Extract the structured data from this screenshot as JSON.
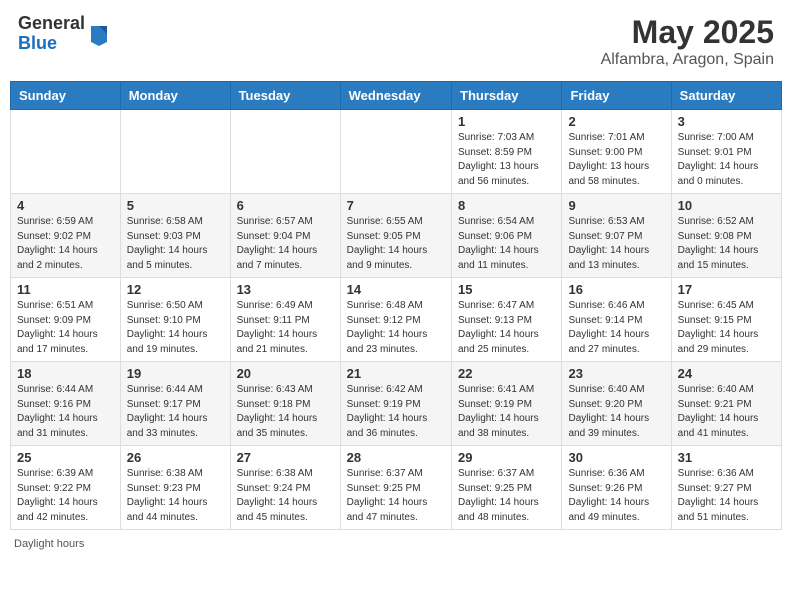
{
  "header": {
    "logo_general": "General",
    "logo_blue": "Blue",
    "month_title": "May 2025",
    "location": "Alfambra, Aragon, Spain"
  },
  "days_of_week": [
    "Sunday",
    "Monday",
    "Tuesday",
    "Wednesday",
    "Thursday",
    "Friday",
    "Saturday"
  ],
  "weeks": [
    [
      {
        "day": "",
        "info": ""
      },
      {
        "day": "",
        "info": ""
      },
      {
        "day": "",
        "info": ""
      },
      {
        "day": "",
        "info": ""
      },
      {
        "day": "1",
        "info": "Sunrise: 7:03 AM\nSunset: 8:59 PM\nDaylight: 13 hours and 56 minutes."
      },
      {
        "day": "2",
        "info": "Sunrise: 7:01 AM\nSunset: 9:00 PM\nDaylight: 13 hours and 58 minutes."
      },
      {
        "day": "3",
        "info": "Sunrise: 7:00 AM\nSunset: 9:01 PM\nDaylight: 14 hours and 0 minutes."
      }
    ],
    [
      {
        "day": "4",
        "info": "Sunrise: 6:59 AM\nSunset: 9:02 PM\nDaylight: 14 hours and 2 minutes."
      },
      {
        "day": "5",
        "info": "Sunrise: 6:58 AM\nSunset: 9:03 PM\nDaylight: 14 hours and 5 minutes."
      },
      {
        "day": "6",
        "info": "Sunrise: 6:57 AM\nSunset: 9:04 PM\nDaylight: 14 hours and 7 minutes."
      },
      {
        "day": "7",
        "info": "Sunrise: 6:55 AM\nSunset: 9:05 PM\nDaylight: 14 hours and 9 minutes."
      },
      {
        "day": "8",
        "info": "Sunrise: 6:54 AM\nSunset: 9:06 PM\nDaylight: 14 hours and 11 minutes."
      },
      {
        "day": "9",
        "info": "Sunrise: 6:53 AM\nSunset: 9:07 PM\nDaylight: 14 hours and 13 minutes."
      },
      {
        "day": "10",
        "info": "Sunrise: 6:52 AM\nSunset: 9:08 PM\nDaylight: 14 hours and 15 minutes."
      }
    ],
    [
      {
        "day": "11",
        "info": "Sunrise: 6:51 AM\nSunset: 9:09 PM\nDaylight: 14 hours and 17 minutes."
      },
      {
        "day": "12",
        "info": "Sunrise: 6:50 AM\nSunset: 9:10 PM\nDaylight: 14 hours and 19 minutes."
      },
      {
        "day": "13",
        "info": "Sunrise: 6:49 AM\nSunset: 9:11 PM\nDaylight: 14 hours and 21 minutes."
      },
      {
        "day": "14",
        "info": "Sunrise: 6:48 AM\nSunset: 9:12 PM\nDaylight: 14 hours and 23 minutes."
      },
      {
        "day": "15",
        "info": "Sunrise: 6:47 AM\nSunset: 9:13 PM\nDaylight: 14 hours and 25 minutes."
      },
      {
        "day": "16",
        "info": "Sunrise: 6:46 AM\nSunset: 9:14 PM\nDaylight: 14 hours and 27 minutes."
      },
      {
        "day": "17",
        "info": "Sunrise: 6:45 AM\nSunset: 9:15 PM\nDaylight: 14 hours and 29 minutes."
      }
    ],
    [
      {
        "day": "18",
        "info": "Sunrise: 6:44 AM\nSunset: 9:16 PM\nDaylight: 14 hours and 31 minutes."
      },
      {
        "day": "19",
        "info": "Sunrise: 6:44 AM\nSunset: 9:17 PM\nDaylight: 14 hours and 33 minutes."
      },
      {
        "day": "20",
        "info": "Sunrise: 6:43 AM\nSunset: 9:18 PM\nDaylight: 14 hours and 35 minutes."
      },
      {
        "day": "21",
        "info": "Sunrise: 6:42 AM\nSunset: 9:19 PM\nDaylight: 14 hours and 36 minutes."
      },
      {
        "day": "22",
        "info": "Sunrise: 6:41 AM\nSunset: 9:19 PM\nDaylight: 14 hours and 38 minutes."
      },
      {
        "day": "23",
        "info": "Sunrise: 6:40 AM\nSunset: 9:20 PM\nDaylight: 14 hours and 39 minutes."
      },
      {
        "day": "24",
        "info": "Sunrise: 6:40 AM\nSunset: 9:21 PM\nDaylight: 14 hours and 41 minutes."
      }
    ],
    [
      {
        "day": "25",
        "info": "Sunrise: 6:39 AM\nSunset: 9:22 PM\nDaylight: 14 hours and 42 minutes."
      },
      {
        "day": "26",
        "info": "Sunrise: 6:38 AM\nSunset: 9:23 PM\nDaylight: 14 hours and 44 minutes."
      },
      {
        "day": "27",
        "info": "Sunrise: 6:38 AM\nSunset: 9:24 PM\nDaylight: 14 hours and 45 minutes."
      },
      {
        "day": "28",
        "info": "Sunrise: 6:37 AM\nSunset: 9:25 PM\nDaylight: 14 hours and 47 minutes."
      },
      {
        "day": "29",
        "info": "Sunrise: 6:37 AM\nSunset: 9:25 PM\nDaylight: 14 hours and 48 minutes."
      },
      {
        "day": "30",
        "info": "Sunrise: 6:36 AM\nSunset: 9:26 PM\nDaylight: 14 hours and 49 minutes."
      },
      {
        "day": "31",
        "info": "Sunrise: 6:36 AM\nSunset: 9:27 PM\nDaylight: 14 hours and 51 minutes."
      }
    ]
  ],
  "footer": {
    "daylight_label": "Daylight hours"
  }
}
